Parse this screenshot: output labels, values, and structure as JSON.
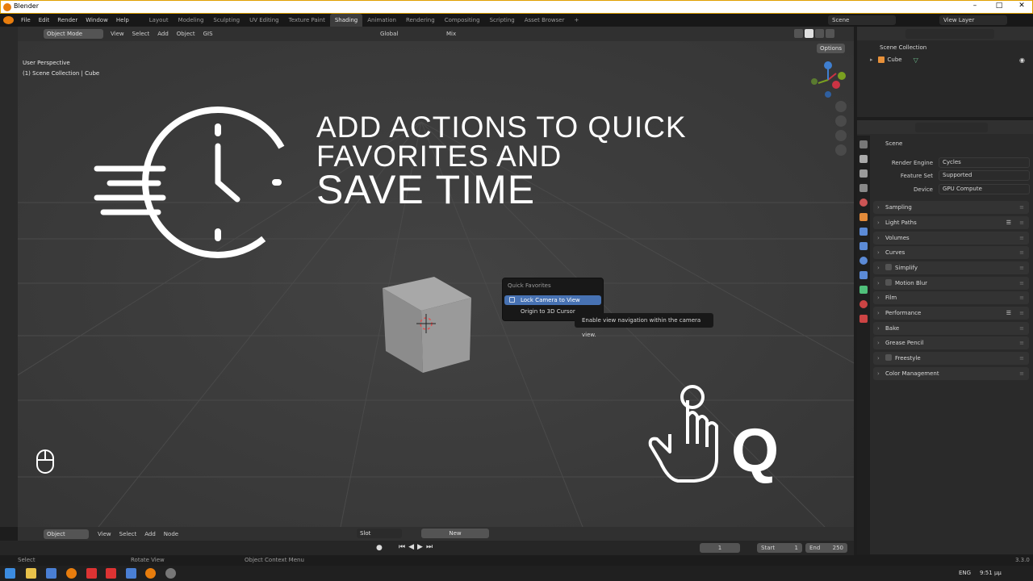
{
  "window": {
    "title": "Blender"
  },
  "menu": {
    "items": [
      "File",
      "Edit",
      "Render",
      "Window",
      "Help"
    ]
  },
  "workspaces": [
    "Layout",
    "Modeling",
    "Sculpting",
    "UV Editing",
    "Texture Paint",
    "Shading",
    "Animation",
    "Rendering",
    "Compositing",
    "Scripting",
    "Asset Browser"
  ],
  "active_workspace": "Shading",
  "scene_field": "Scene",
  "view_layer_field": "View Layer",
  "viewport_header": {
    "mode": "Object Mode",
    "menus": [
      "View",
      "Select",
      "Add",
      "Object",
      "GIS"
    ],
    "orientation": "Global",
    "pivot": "Mix",
    "options": "Options"
  },
  "viewport": {
    "perspective": "User Perspective",
    "collection_info": "(1) Scene Collection | Cube"
  },
  "overlay": {
    "headline_line1": "ADD ACTIONS TO QUICK",
    "headline_line2": "FAVORITES AND",
    "headline_line3": "SAVE TIME",
    "key": "Q"
  },
  "quick_favorites": {
    "title": "Quick Favorites",
    "items": [
      "Lock Camera to View",
      "Origin to 3D Cursor"
    ],
    "tooltip": "Enable view navigation within the camera view."
  },
  "outliner": {
    "root": "Scene Collection",
    "object": "Cube"
  },
  "properties": {
    "context": "Scene",
    "render_engine_label": "Render Engine",
    "render_engine": "Cycles",
    "feature_set_label": "Feature Set",
    "feature_set": "Supported",
    "device_label": "Device",
    "device": "GPU Compute",
    "panels": [
      "Sampling",
      "Light Paths",
      "Volumes",
      "Curves",
      "Simplify",
      "Motion Blur",
      "Film",
      "Performance",
      "Bake",
      "Grease Pencil",
      "Freestyle",
      "Color Management"
    ]
  },
  "shader_header": {
    "mode": "Object",
    "menus": [
      "View",
      "Select",
      "Add",
      "Node"
    ],
    "slot": "Slot",
    "new_button": "New"
  },
  "timeline": {
    "current_frame": "1",
    "start_label": "Start",
    "start": "1",
    "end_label": "End",
    "end": "250"
  },
  "status": {
    "left": "Select",
    "middle": "Rotate View",
    "right": "Object Context Menu",
    "version": "3.3.0"
  },
  "taskbar": {
    "language": "ENG",
    "time": "9:51 μμ"
  },
  "colors": {
    "accent": "#4772b3",
    "viewport_bg": "#3a3a3a",
    "overlay_text": "#ffffff"
  }
}
